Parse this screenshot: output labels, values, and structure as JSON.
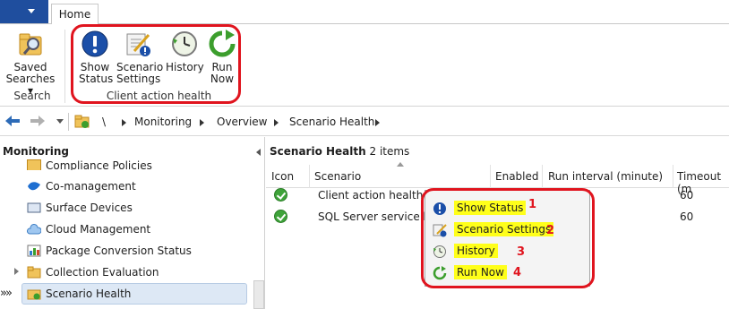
{
  "ribbon": {
    "tabs": {
      "home": "Home"
    },
    "search_group": {
      "saved_searches_line1": "Saved",
      "saved_searches_line2": "Searches ▾",
      "label": "Search"
    },
    "client_action_group": {
      "show_status_1": "Show",
      "show_status_2": "Status",
      "scenario_settings_1": "Scenario",
      "scenario_settings_2": "Settings",
      "history": "History",
      "run_now_1": "Run",
      "run_now_2": "Now",
      "label": "Client action health"
    }
  },
  "breadcrumb": {
    "root": "\\",
    "items": [
      "Monitoring",
      "Overview",
      "Scenario Health"
    ]
  },
  "nav": {
    "title": "Monitoring",
    "items": [
      {
        "label": "Compliance Policies",
        "icon": "compliance-icon"
      },
      {
        "label": "Co-management",
        "icon": "co-management-icon"
      },
      {
        "label": "Surface Devices",
        "icon": "surface-devices-icon"
      },
      {
        "label": "Cloud Management",
        "icon": "cloud-icon"
      },
      {
        "label": "Package Conversion Status",
        "icon": "chart-icon"
      },
      {
        "label": "Collection Evaluation",
        "icon": "folder-icon"
      },
      {
        "label": "Scenario Health",
        "icon": "scenario-health-icon"
      }
    ]
  },
  "pane": {
    "title": "Scenario Health",
    "count": "2 items",
    "columns": [
      "Icon",
      "Scenario",
      "Enabled",
      "Run interval (minute)",
      "Timeout (m"
    ],
    "rows": [
      {
        "scenario": "Client action health",
        "timeout": "60"
      },
      {
        "scenario": "SQL Server service bro",
        "timeout": "60"
      }
    ]
  },
  "context_menu": {
    "items": [
      {
        "label": "Show Status",
        "number": "1"
      },
      {
        "label": "Scenario Settings",
        "number": "2"
      },
      {
        "label": "History",
        "number": "3"
      },
      {
        "label": "Run Now",
        "number": "4"
      }
    ]
  },
  "colors": {
    "accent": "#1f4e9e",
    "highlight": "#ffff1a",
    "annotation": "#e0141e"
  }
}
